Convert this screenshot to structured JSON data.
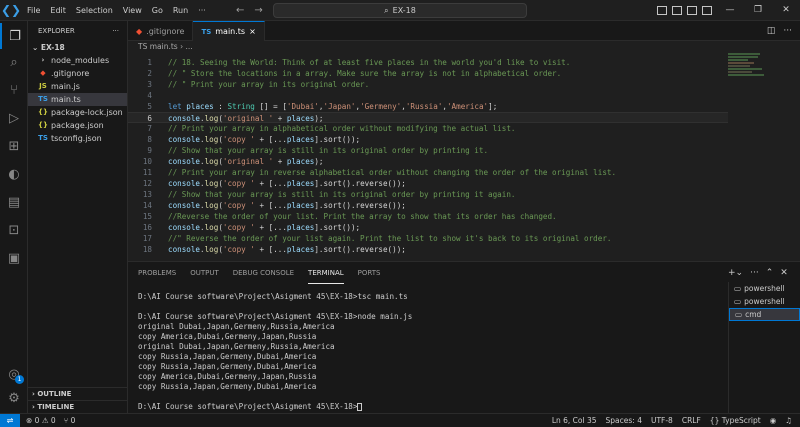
{
  "window": {
    "search_text": "EX-18"
  },
  "menu": [
    "File",
    "Edit",
    "Selection",
    "View",
    "Go",
    "Run",
    "···"
  ],
  "window_controls": [
    "—",
    "❐",
    "✕"
  ],
  "sidebar": {
    "title": "EXPLORER",
    "folder": "EX-18",
    "items": [
      {
        "icon": "›",
        "label": "node_modules"
      },
      {
        "icon": "◆",
        "label": ".gitignore"
      },
      {
        "icon": "JS",
        "label": "main.js"
      },
      {
        "icon": "TS",
        "label": "main.ts"
      },
      {
        "icon": "{}",
        "label": "package-lock.json"
      },
      {
        "icon": "{}",
        "label": "package.json"
      },
      {
        "icon": "TS",
        "label": "tsconfig.json"
      }
    ],
    "outline": "OUTLINE",
    "timeline": "TIMELINE"
  },
  "tabs": [
    {
      "label": ".gitignore"
    },
    {
      "label": "main.ts",
      "close": "×"
    }
  ],
  "breadcrumb": "TS main.ts › ...",
  "editor": {
    "line_numbers": [
      "1",
      "2",
      "3",
      "4",
      "5",
      "6",
      "7",
      "8",
      "9",
      "10",
      "11",
      "12",
      "13",
      "14",
      "15",
      "16",
      "17",
      "18"
    ],
    "lines": [
      "// 18. Seeing the World: Think of at least five places in the world you'd like to visit.",
      "// \" Store the locations in a array. Make sure the array is not in alphabetical order.",
      "// \" Print your array in its original order.",
      "",
      "let places : String [] = ['Dubai','Japan','Germeny','Russia','America'];",
      "console.log('original ' + places);",
      "// Print your array in alphabetical order without modifying the actual list.",
      "console.log('copy ' + [...places].sort());",
      "// Show that your array is still in its original order by printing it.",
      "console.log('original ' + places);",
      "// Print your array in reverse alphabetical order without changing the order of the original list.",
      "console.log('copy ' + [...places].sort().reverse());",
      "// Show that your array is still in its original order by printing it again.",
      "console.log('copy ' + [...places].sort().reverse());",
      "//Reverse the order of your list. Print the array to show that its order has changed.",
      "console.log('copy ' + [...places].sort());",
      "//\" Reverse the order of your list again. Print the list to show it's back to its original order.",
      "console.log('copy ' + [...places].sort().reverse());"
    ]
  },
  "panel": {
    "tabs": [
      "PROBLEMS",
      "OUTPUT",
      "DEBUG CONSOLE",
      "TERMINAL",
      "PORTS"
    ],
    "terminal_lines": [
      "D:\\AI Course software\\Project\\Asigment 45\\EX-18>tsc main.ts",
      "",
      "D:\\AI Course software\\Project\\Asigment 45\\EX-18>node main.js",
      "original Dubai,Japan,Germeny,Russia,America",
      "copy America,Dubai,Germeny,Japan,Russia",
      "original Dubai,Japan,Germeny,Russia,America",
      "copy Russia,Japan,Germeny,Dubai,America",
      "copy Russia,Japan,Germeny,Dubai,America",
      "copy America,Dubai,Germeny,Japan,Russia",
      "copy Russia,Japan,Germeny,Dubai,America",
      "",
      "D:\\AI Course software\\Project\\Asigment 45\\EX-18>"
    ],
    "terminals": [
      "powershell",
      "powershell",
      "cmd"
    ]
  },
  "statusbar": {
    "errors": "⊗ 0 ⚠ 0",
    "ports": "⑂ 0",
    "position": "Ln 6, Col 35",
    "spaces": "Spaces: 4",
    "encoding": "UTF-8",
    "eol": "CRLF",
    "language": "{} TypeScript"
  },
  "colors": {
    "accent": "#0078d4",
    "comment": "#6a9955",
    "string": "#ce9178",
    "keyword": "#569cd6",
    "variable": "#9cdcfe",
    "function": "#dcdcaa",
    "type": "#4ec9b0"
  }
}
